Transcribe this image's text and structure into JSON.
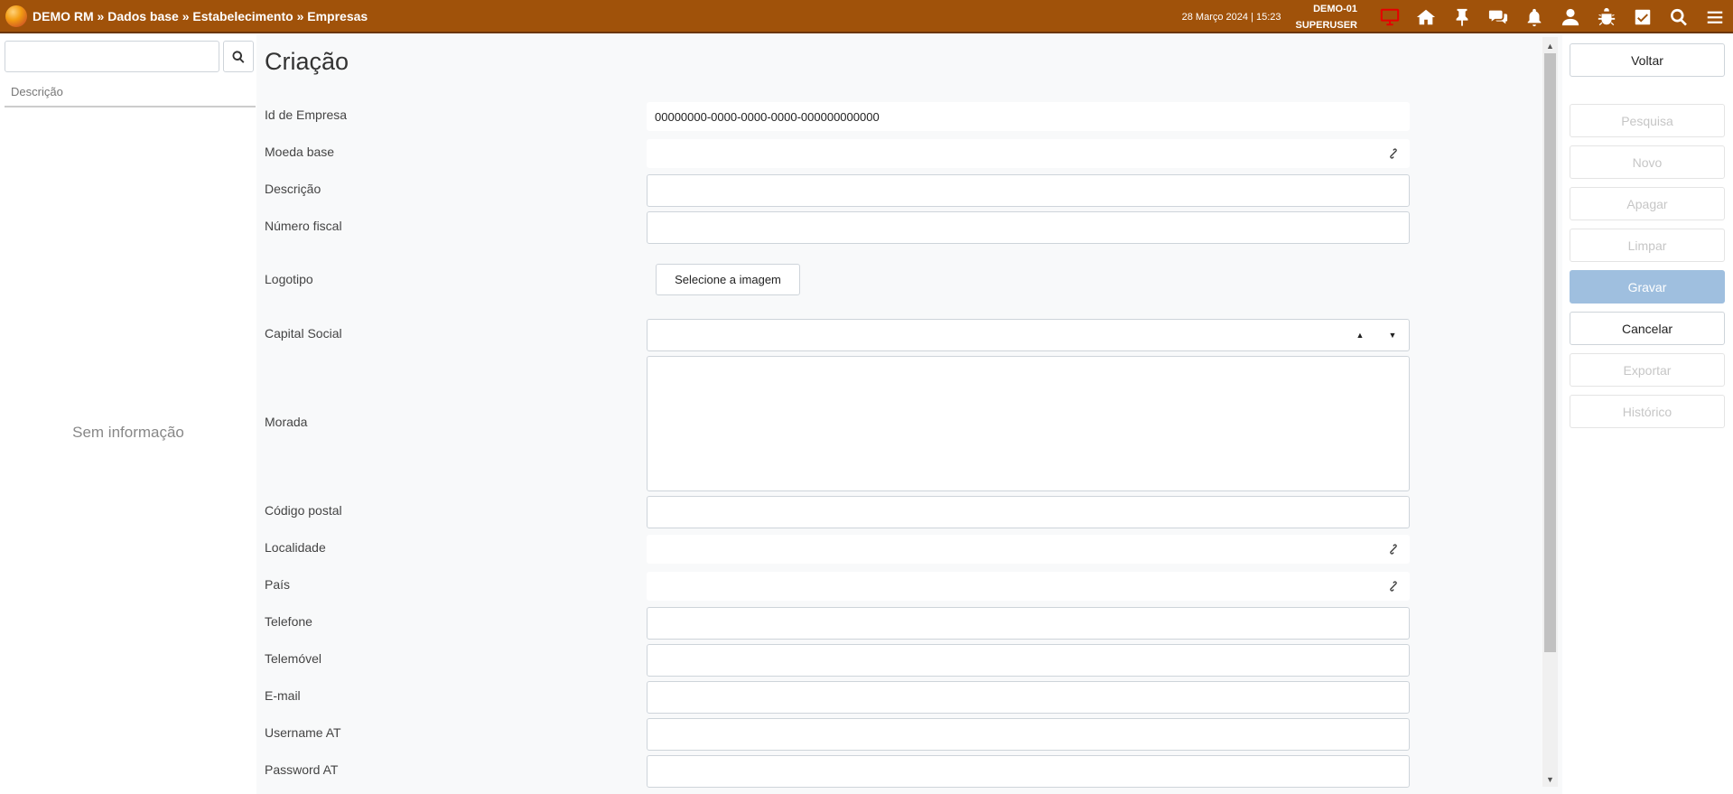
{
  "header": {
    "app": "DEMO RM",
    "crumbs": [
      "Dados base",
      "Estabelecimento",
      "Empresas"
    ],
    "separator": " » ",
    "datetime": "28 Março 2024 | 15:23",
    "company": "DEMO-01",
    "user": "SUPERUSER",
    "accent": "#a0520a",
    "icons": [
      "monitor-icon",
      "home-icon",
      "pin-icon",
      "chat-icon",
      "bell-icon",
      "user-icon",
      "bug-icon",
      "checkbox-icon",
      "search-icon",
      "menu-icon"
    ]
  },
  "left_panel": {
    "search_value": "",
    "column_header": "Descrição",
    "empty_text": "Sem informação"
  },
  "form": {
    "title": "Criação",
    "fields": {
      "id_empresa": {
        "label": "Id de Empresa",
        "value": "00000000-0000-0000-0000-000000000000"
      },
      "moeda_base": {
        "label": "Moeda base",
        "value": ""
      },
      "descricao": {
        "label": "Descrição",
        "value": ""
      },
      "numero_fiscal": {
        "label": "Número fiscal",
        "value": ""
      },
      "logotipo": {
        "label": "Logotipo",
        "button": "Selecione a imagem"
      },
      "capital_social": {
        "label": "Capital Social",
        "value": ""
      },
      "morada": {
        "label": "Morada",
        "value": ""
      },
      "codigo_postal": {
        "label": "Código postal",
        "value": ""
      },
      "localidade": {
        "label": "Localidade",
        "value": ""
      },
      "pais": {
        "label": "País",
        "value": ""
      },
      "telefone": {
        "label": "Telefone",
        "value": ""
      },
      "telemovel": {
        "label": "Telemóvel",
        "value": ""
      },
      "email": {
        "label": "E-mail",
        "value": ""
      },
      "username_at": {
        "label": "Username AT",
        "value": ""
      },
      "password_at": {
        "label": "Password AT",
        "value": ""
      }
    }
  },
  "actions": {
    "voltar": "Voltar",
    "pesquisa": "Pesquisa",
    "novo": "Novo",
    "apagar": "Apagar",
    "limpar": "Limpar",
    "gravar": "Gravar",
    "cancelar": "Cancelar",
    "exportar": "Exportar",
    "historico": "Histórico"
  }
}
